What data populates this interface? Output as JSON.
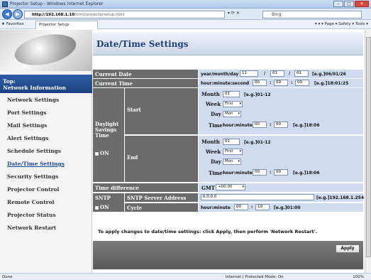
{
  "window": {
    "title": "Projector Setup - Windows Internet Explorer",
    "minimize": "–",
    "maximize": "□",
    "close": "✕"
  },
  "address": {
    "url_host": "http://192.168.1.10",
    "url_path": "/html/projectorsetup.html",
    "search_placeholder": "Bing",
    "icons": "▾ ⟳ ✕"
  },
  "favorites": {
    "favorites_label": "Favorites",
    "tab_label": "Projector Setup",
    "tools_text": "▾ ▾ ▾ Page ▾ Safety ▾ Tools ▾"
  },
  "sidebar": {
    "top_line1": "Top:",
    "top_line2": "Network Information",
    "items": [
      {
        "label": "Network Settings"
      },
      {
        "label": "Port Settings"
      },
      {
        "label": "Mail Settings"
      },
      {
        "label": "Alert Settings"
      },
      {
        "label": "Schedule Settings"
      },
      {
        "label": "Date/Time Settings"
      },
      {
        "label": "Security Settings"
      },
      {
        "label": "Projector Control"
      },
      {
        "label": "Remote Control"
      },
      {
        "label": "Projector Status"
      },
      {
        "label": "Network Restart"
      }
    ]
  },
  "page": {
    "title": "Date/Time Settings"
  },
  "current_date": {
    "label": "Current Date",
    "format": "year/month/day",
    "year": "11",
    "month": "01",
    "day": "01",
    "sep": "/",
    "example": "[e.g.]06/01/26"
  },
  "current_time": {
    "label": "Current Time",
    "format": "hour:minute:second",
    "hour": "00",
    "minute": "00",
    "second": "00",
    "sep": ":",
    "example": "[e.g.]18:01:25"
  },
  "dst": {
    "label_line1": "Daylight",
    "label_line2": "Savings",
    "label_line3": "Time",
    "on_label": "ON",
    "start": {
      "label": "Start",
      "month_label": "Month",
      "month_value": "01",
      "month_hint": "[e.g.]01-12",
      "week_label": "Week",
      "week_value": "First",
      "day_label": "Day",
      "day_value": "Mon",
      "time_label": "Time",
      "time_format": "hour:minute",
      "hour": "00",
      "minute": "00",
      "sep": ":",
      "time_hint": "[e.g.]18:06"
    },
    "end": {
      "label": "End",
      "month_label": "Month",
      "month_value": "01",
      "month_hint": "[e.g.]01-12",
      "week_label": "Week",
      "week_value": "First",
      "day_label": "Day",
      "day_value": "Mon",
      "time_label": "Time",
      "time_format": "hour:minute",
      "hour": "00",
      "minute": "00",
      "sep": ":",
      "time_hint": "[e.g.]18:06"
    }
  },
  "time_difference": {
    "label": "Time difference",
    "gmt_label": "GMT",
    "value": "+00:00"
  },
  "sntp": {
    "label": "SNTP",
    "on_label": "ON",
    "server_label": "SNTP Server Address",
    "server_value": "0.0.0.0",
    "server_example": "[e.g.]192.168.1.254",
    "cycle_label": "Cycle",
    "cycle_format": "hour:minute",
    "cycle_hour": "00",
    "cycle_minute": "10",
    "sep": ":",
    "cycle_example": "[e.g.]01:00"
  },
  "apply_note": "To apply changes to date/time settings: click Apply, then perform 'Network Restart'.",
  "apply_label": "Apply",
  "status": {
    "left": "Done",
    "middle": "Internet | Protected Mode: On",
    "zoom": "100%"
  }
}
